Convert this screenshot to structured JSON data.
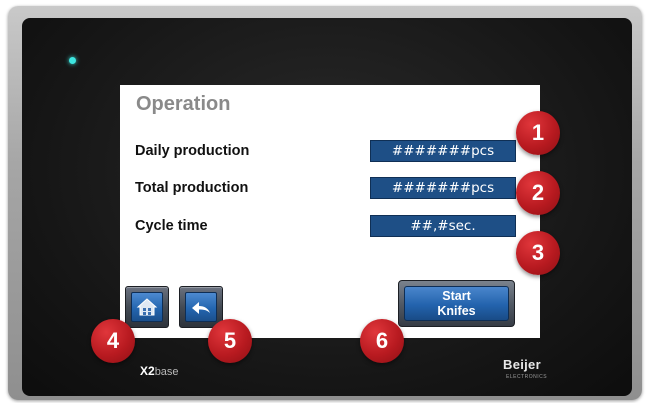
{
  "screen": {
    "title": "Operation",
    "rows": [
      {
        "label": "Daily production",
        "value": "#######pcs"
      },
      {
        "label": "Total production",
        "value": "#######pcs"
      },
      {
        "label": "Cycle time",
        "value": "##,#sec."
      }
    ]
  },
  "buttons": {
    "home_icon": "home-icon",
    "back_icon": "back-arrow-icon",
    "start_line1": "Start",
    "start_line2": "Knifes"
  },
  "callouts": [
    "1",
    "2",
    "3",
    "4",
    "5",
    "6"
  ],
  "device": {
    "model_prefix": "X2",
    "model_suffix": "base",
    "brand": "Beijer",
    "brand_sub": "ELECTRONICS"
  },
  "colors": {
    "value_box": "#1e4f86",
    "button_face": "#2466b0",
    "callout": "#b81a20",
    "led": "#3ee6e0"
  }
}
